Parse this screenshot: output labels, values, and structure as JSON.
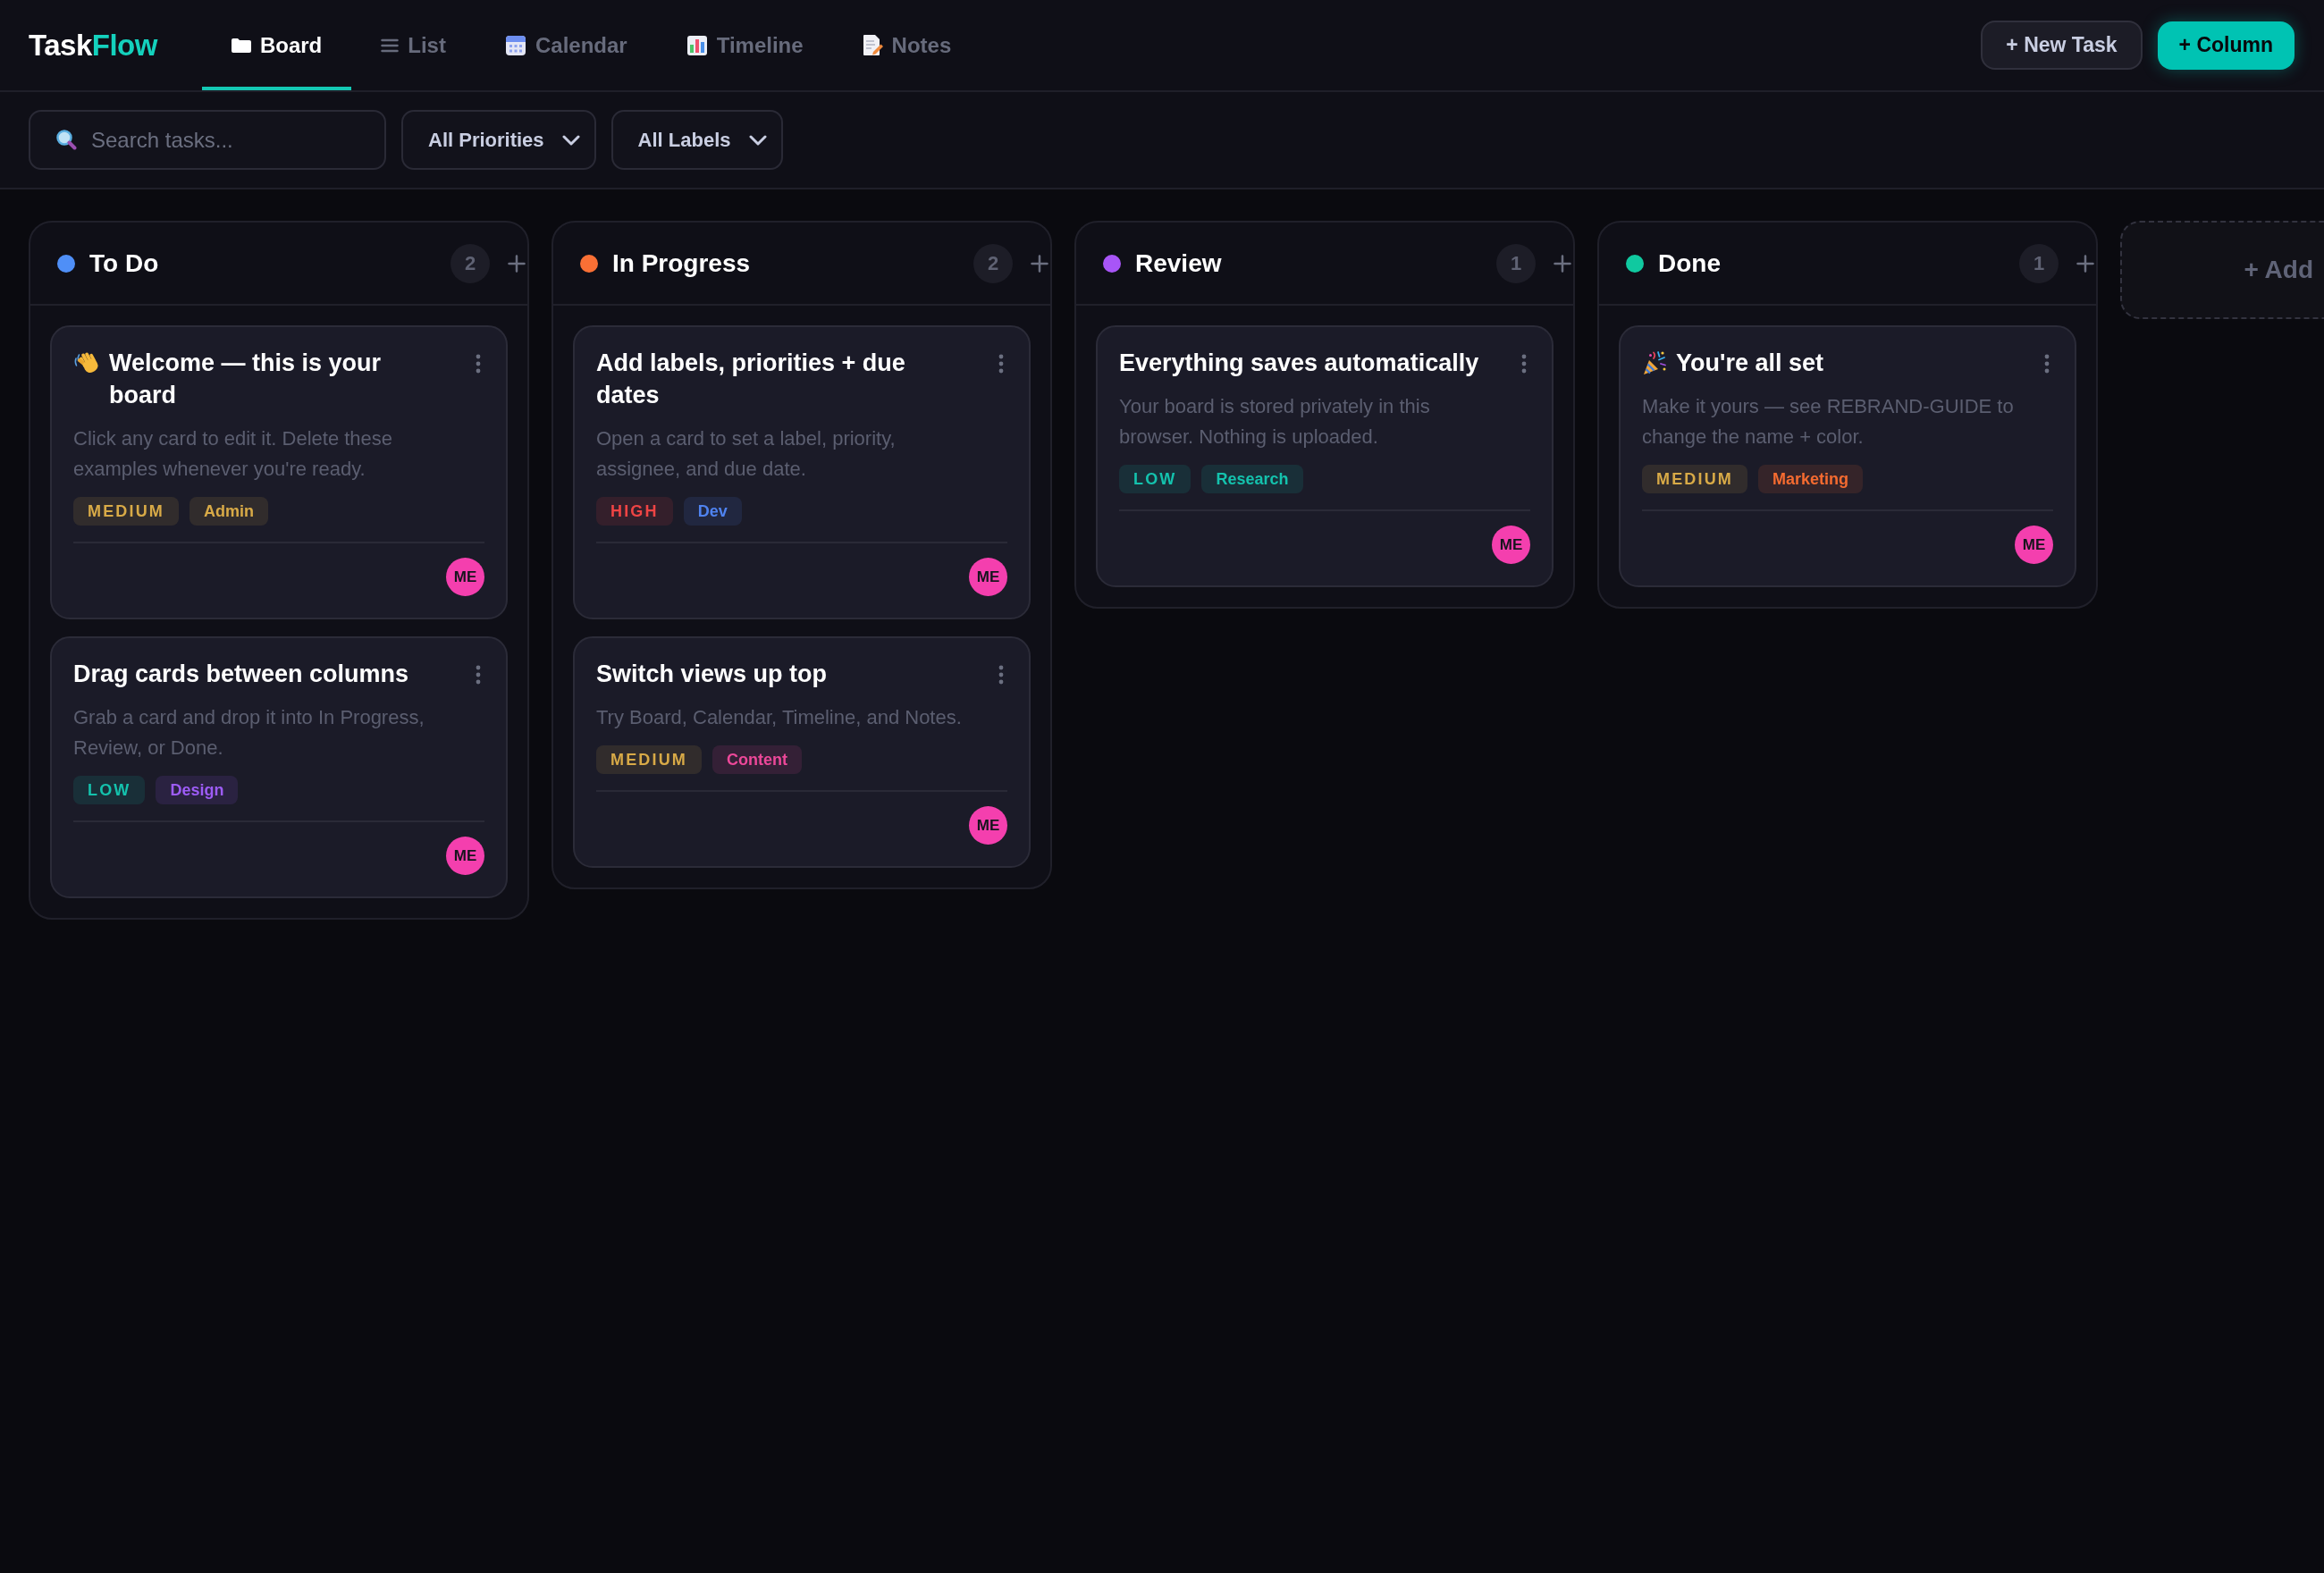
{
  "logo": {
    "main": "Task",
    "accent": "Flow"
  },
  "view_tabs": [
    {
      "label": "Board",
      "selected": true
    },
    {
      "label": "List",
      "selected": false
    },
    {
      "label": "Calendar",
      "selected": false
    },
    {
      "label": "Timeline",
      "selected": false
    },
    {
      "label": "Notes",
      "selected": false
    }
  ],
  "header_buttons": [
    {
      "kind": "secondary",
      "label": "+ New Task"
    },
    {
      "kind": "primary",
      "label": "+ Column"
    }
  ],
  "filters": {
    "search": {
      "placeholder": "Search tasks..."
    },
    "dropdowns": [
      {
        "value": "All Priorities"
      },
      {
        "value": "All Labels"
      }
    ]
  },
  "columns": [
    {
      "title": "To Do",
      "color": "#4f8ff7",
      "count": "2",
      "cards": [
        {
          "kind": "greeting",
          "title": "Welcome — this is your board",
          "description": "Click any card to edit it. Delete these examples whenever you're ready.",
          "tags": [
            {
              "kind": "priority",
              "text": "MEDIUM",
              "color": "#d8aa47"
            },
            {
              "kind": "label",
              "text": "Admin",
              "color": "#d8aa47"
            }
          ],
          "assignee": "ME"
        },
        {
          "kind": "task",
          "title": "Drag cards between columns",
          "description": "Grab a card and drop it into In Progress, Review, or Done.",
          "tags": [
            {
              "kind": "priority",
              "text": "LOW",
              "color": "#14c2ad"
            },
            {
              "kind": "label",
              "text": "Design",
              "color": "#9d5cf6"
            }
          ],
          "assignee": "ME"
        }
      ]
    },
    {
      "title": "In Progress",
      "color": "#f97035",
      "count": "2",
      "cards": [
        {
          "kind": "task",
          "title": "Add labels, priorities + due dates",
          "description": "Open a card to set a label, priority, assignee, and due date.",
          "tags": [
            {
              "kind": "priority",
              "text": "HIGH",
              "color": "#ef4444"
            },
            {
              "kind": "label",
              "text": "Dev",
              "color": "#4f83f0"
            }
          ],
          "assignee": "ME"
        },
        {
          "kind": "task",
          "title": "Switch views up top",
          "description": "Try Board, Calendar, Timeline, and Notes.",
          "tags": [
            {
              "kind": "priority",
              "text": "MEDIUM",
              "color": "#d8aa47"
            },
            {
              "kind": "label",
              "text": "Content",
              "color": "#ec4899"
            }
          ],
          "assignee": "ME"
        }
      ]
    },
    {
      "title": "Review",
      "color": "#a855f7",
      "count": "1",
      "cards": [
        {
          "kind": "task",
          "title": "Everything saves automatically",
          "description": "Your board is stored privately in this browser. Nothing is uploaded.",
          "tags": [
            {
              "kind": "priority",
              "text": "LOW",
              "color": "#14c2ad"
            },
            {
              "kind": "label",
              "text": "Research",
              "color": "#14c2ad"
            }
          ],
          "assignee": "ME"
        }
      ]
    },
    {
      "title": "Done",
      "color": "#10c9a0",
      "count": "1",
      "cards": [
        {
          "kind": "celebration",
          "title": "You're all set",
          "description": "Make it yours — see REBRAND-GUIDE to change the name + color.",
          "tags": [
            {
              "kind": "priority",
              "text": "MEDIUM",
              "color": "#d8aa47"
            },
            {
              "kind": "label",
              "text": "Marketing",
              "color": "#f56b30"
            }
          ],
          "assignee": "ME"
        }
      ]
    }
  ],
  "add_column": {
    "label": "+ Add"
  }
}
